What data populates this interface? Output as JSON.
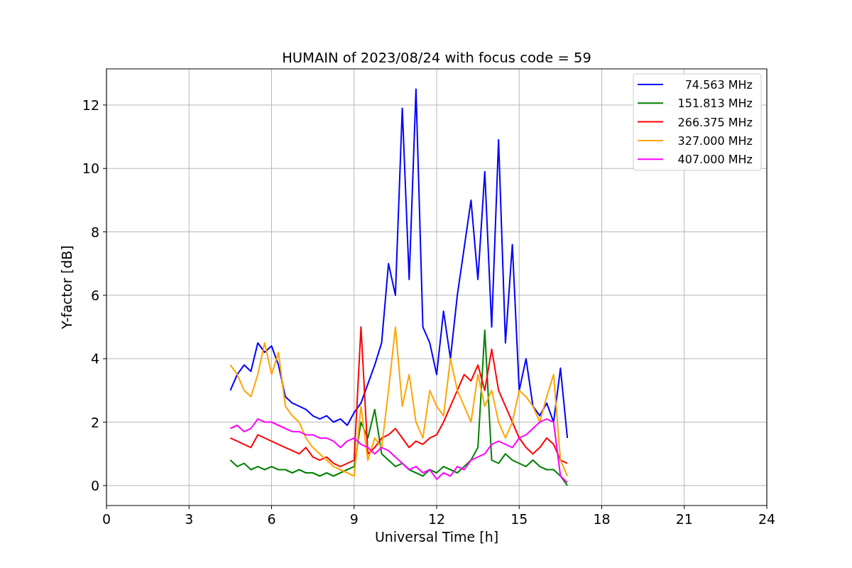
{
  "chart_data": {
    "type": "line",
    "title": "HUMAIN of 2023/08/24 with focus code = 59",
    "xlabel": "Universal Time [h]",
    "ylabel": "Y-factor [dB]",
    "x": [
      4.5,
      4.75,
      5,
      5.25,
      5.5,
      5.75,
      6,
      6.25,
      6.5,
      6.75,
      7,
      7.25,
      7.5,
      7.75,
      8,
      8.25,
      8.5,
      8.75,
      9,
      9.25,
      9.5,
      9.75,
      10,
      10.25,
      10.5,
      10.75,
      11,
      11.25,
      11.5,
      11.75,
      12,
      12.25,
      12.5,
      12.75,
      13,
      13.25,
      13.5,
      13.75,
      14,
      14.25,
      14.5,
      14.75,
      15,
      15.25,
      15.5,
      15.75,
      16,
      16.25,
      16.5,
      16.75
    ],
    "series": [
      {
        "name": "74.563 MHz",
        "color": "#0000ff",
        "values": [
          3.0,
          3.5,
          3.8,
          3.6,
          4.5,
          4.2,
          4.4,
          3.8,
          2.8,
          2.6,
          2.5,
          2.4,
          2.2,
          2.1,
          2.2,
          2.0,
          2.1,
          1.9,
          2.3,
          2.6,
          3.2,
          3.8,
          4.5,
          7.0,
          6.0,
          11.9,
          6.5,
          12.5,
          5.0,
          4.5,
          3.5,
          5.5,
          4.0,
          6.0,
          7.5,
          9.0,
          6.5,
          9.9,
          5.0,
          10.9,
          4.5,
          7.6,
          3.0,
          4.0,
          2.5,
          2.2,
          2.6,
          2.0,
          3.7,
          1.5
        ]
      },
      {
        "name": "151.813 MHz",
        "color": "#008000",
        "values": [
          0.8,
          0.6,
          0.7,
          0.5,
          0.6,
          0.5,
          0.6,
          0.5,
          0.5,
          0.4,
          0.5,
          0.4,
          0.4,
          0.3,
          0.4,
          0.3,
          0.4,
          0.5,
          0.6,
          2.0,
          1.5,
          2.4,
          1.0,
          0.8,
          0.6,
          0.7,
          0.5,
          0.4,
          0.3,
          0.5,
          0.4,
          0.6,
          0.5,
          0.4,
          0.6,
          0.8,
          1.2,
          4.9,
          0.8,
          0.7,
          1.0,
          0.8,
          0.7,
          0.6,
          0.8,
          0.6,
          0.5,
          0.5,
          0.3,
          0.0
        ]
      },
      {
        "name": "266.375 MHz",
        "color": "#ff0000",
        "values": [
          1.5,
          1.4,
          1.3,
          1.2,
          1.6,
          1.5,
          1.4,
          1.3,
          1.2,
          1.1,
          1.0,
          1.2,
          0.9,
          0.8,
          0.9,
          0.7,
          0.6,
          0.7,
          0.8,
          5.0,
          1.0,
          1.2,
          1.5,
          1.6,
          1.8,
          1.5,
          1.2,
          1.4,
          1.3,
          1.5,
          1.6,
          2.0,
          2.5,
          3.0,
          3.5,
          3.3,
          3.8,
          3.0,
          4.3,
          3.0,
          2.5,
          2.0,
          1.5,
          1.2,
          1.0,
          1.2,
          1.5,
          1.3,
          0.8,
          0.7
        ]
      },
      {
        "name": "327.000 MHz",
        "color": "#ffa500",
        "values": [
          3.8,
          3.5,
          3.0,
          2.8,
          3.5,
          4.5,
          3.5,
          4.2,
          2.5,
          2.2,
          2.0,
          1.5,
          1.2,
          1.0,
          0.8,
          0.6,
          0.5,
          0.4,
          0.3,
          2.5,
          0.8,
          1.5,
          1.2,
          3.0,
          5.0,
          2.5,
          3.5,
          2.0,
          1.5,
          3.0,
          2.5,
          2.2,
          4.0,
          3.0,
          2.5,
          2.0,
          3.5,
          2.5,
          3.0,
          2.0,
          1.5,
          2.0,
          3.0,
          2.8,
          2.5,
          2.0,
          2.8,
          3.5,
          0.8,
          0.3
        ]
      },
      {
        "name": "407.000 MHz",
        "color": "#ff00ff",
        "values": [
          1.8,
          1.9,
          1.7,
          1.8,
          2.1,
          2.0,
          2.0,
          1.9,
          1.8,
          1.7,
          1.7,
          1.6,
          1.6,
          1.5,
          1.5,
          1.4,
          1.2,
          1.4,
          1.5,
          1.3,
          1.2,
          1.0,
          1.2,
          1.1,
          0.9,
          0.7,
          0.5,
          0.6,
          0.4,
          0.5,
          0.2,
          0.4,
          0.3,
          0.6,
          0.5,
          0.8,
          0.9,
          1.0,
          1.3,
          1.4,
          1.3,
          1.2,
          1.5,
          1.6,
          1.8,
          2.0,
          2.1,
          2.0,
          0.3,
          0.1
        ]
      }
    ],
    "xlim": [
      0,
      24
    ],
    "ylim": [
      -0.63,
      13.14
    ],
    "xticks": [
      0,
      3,
      6,
      9,
      12,
      15,
      18,
      21,
      24
    ],
    "yticks": [
      0,
      2,
      4,
      6,
      8,
      10,
      12
    ],
    "grid": true,
    "legend": "upper right"
  }
}
